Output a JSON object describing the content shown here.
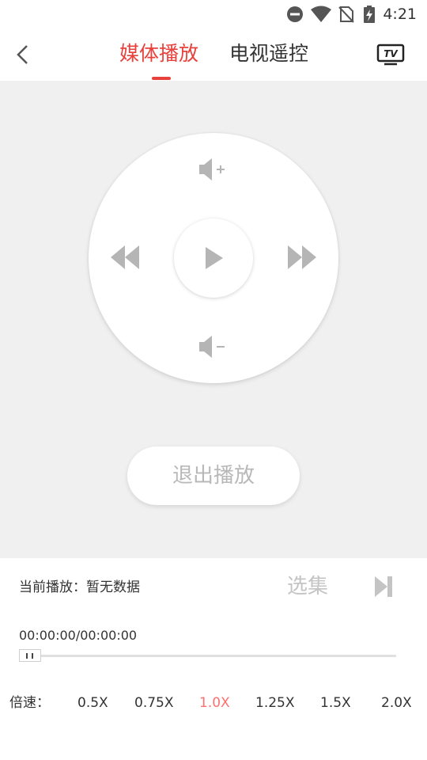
{
  "status_bar": {
    "time": "4:21",
    "icons": [
      "do-not-disturb-icon",
      "wifi-icon",
      "no-sim-icon",
      "battery-charging-icon"
    ]
  },
  "header": {
    "back_icon": "chevron-left-icon",
    "tabs": [
      {
        "label": "媒体播放",
        "active": true
      },
      {
        "label": "电视遥控",
        "active": false
      }
    ],
    "tv_icon_label": "TV",
    "accent_color": "#e8413b"
  },
  "remote": {
    "volume_up_icon": "volume-up-icon",
    "volume_down_icon": "volume-down-icon",
    "rewind_icon": "rewind-icon",
    "fast_forward_icon": "fast-forward-icon",
    "play_icon": "play-icon",
    "exit_label": "退出播放"
  },
  "player": {
    "now_playing": "当前播放：暂无数据",
    "episodes_label": "选集",
    "next_icon": "skip-next-icon",
    "time": "00:00:00/00:00:00",
    "progress": 0
  },
  "speed": {
    "label": "倍速：",
    "options": [
      "0.5X",
      "0.75X",
      "1.0X",
      "1.25X",
      "1.5X",
      "2.0X"
    ],
    "selected": "1.0X",
    "selected_color": "#ff6f6f"
  }
}
